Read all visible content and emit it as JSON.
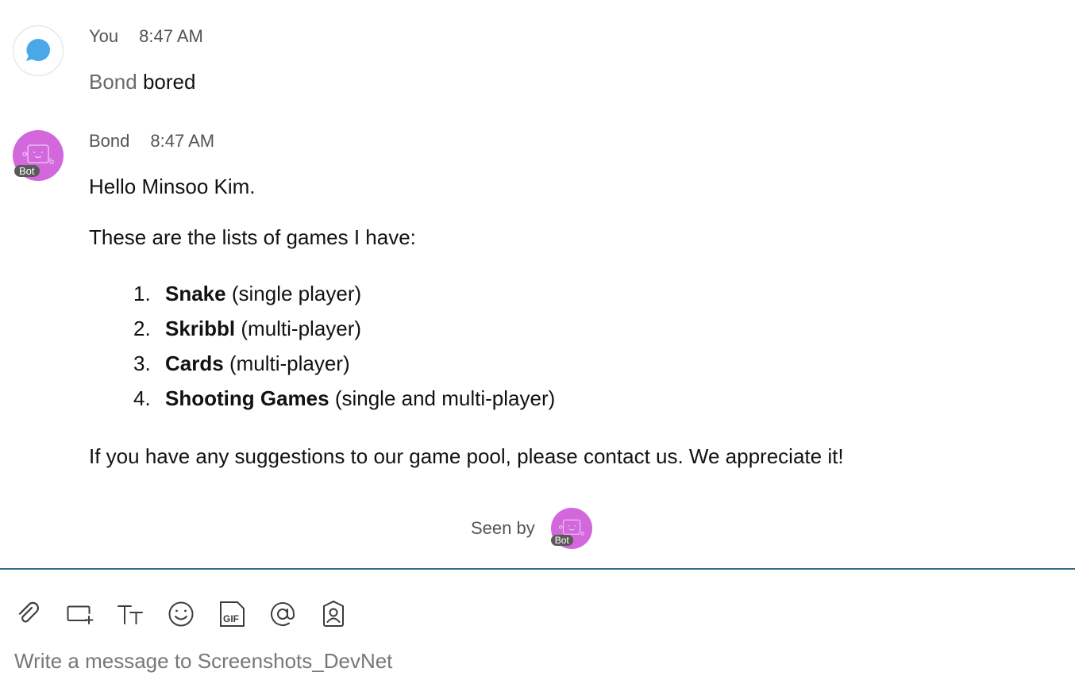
{
  "messages": [
    {
      "sender": "You",
      "time": "8:47 AM",
      "mention": "Bond",
      "text": "bored"
    },
    {
      "sender": "Bond",
      "time": "8:47 AM",
      "badge": "Bot",
      "greeting": "Hello Minsoo Kim.",
      "intro": "These are the lists of games I have:",
      "games": [
        {
          "num": "1.",
          "name": "Snake",
          "detail": "(single player)"
        },
        {
          "num": "2.",
          "name": "Skribbl",
          "detail": "(multi-player)"
        },
        {
          "num": "3.",
          "name": "Cards",
          "detail": "(multi-player)"
        },
        {
          "num": "4.",
          "name": "Shooting Games",
          "detail": "(single and multi-player)"
        }
      ],
      "closing": "If you have any suggestions to our game pool, please contact us. We appreciate it!"
    }
  ],
  "seen": {
    "label": "Seen by",
    "badge": "Bot"
  },
  "toolbar": {
    "icons": [
      "paperclip-icon",
      "share-screen-icon",
      "text-format-icon",
      "emoji-icon",
      "gif-icon",
      "mention-icon",
      "contact-card-icon"
    ]
  },
  "composer": {
    "placeholder": "Write a message to Screenshots_DevNet"
  },
  "colors": {
    "bot_avatar": "#d268dc",
    "user_bubble": "#4aa8e8",
    "divider": "#2c6b8a"
  }
}
